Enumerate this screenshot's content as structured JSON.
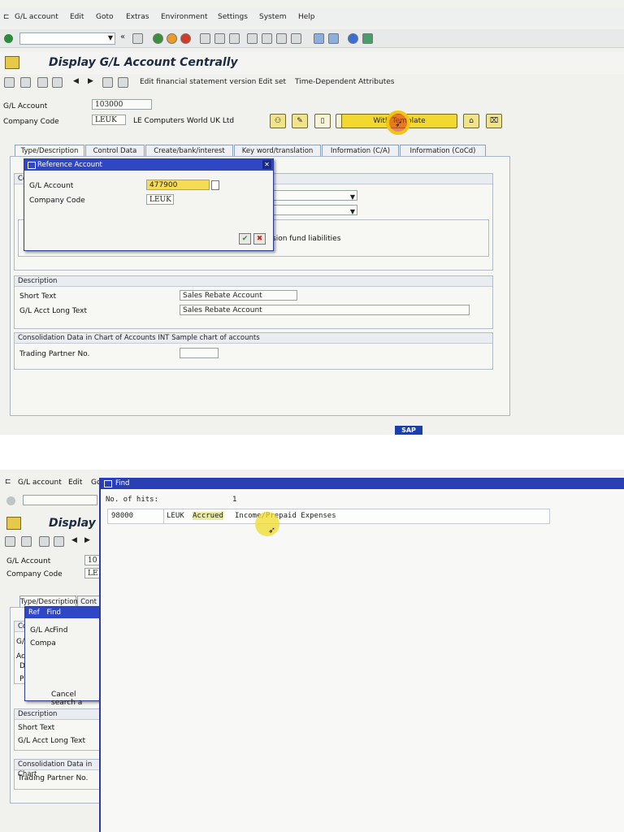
{
  "shot1": {
    "menu": [
      "G/L account",
      "Edit",
      "Goto",
      "Extras",
      "Environment",
      "Settings",
      "System",
      "Help"
    ],
    "title": "Display G/L Account Centrally",
    "app_toolbar": [
      "Edit financial statement version",
      "Edit set",
      "Time-Dependent Attributes"
    ],
    "gl_account_label": "G/L Account",
    "gl_account_value": "103000",
    "company_code_label": "Company Code",
    "company_code_value": "LEUK",
    "company_name": "LE Computers World UK Ltd",
    "with_template_label": "With Template",
    "tabs": [
      "Type/Description",
      "Control Data",
      "Create/bank/interest",
      "Key word/translation",
      "Information (C/A)",
      "Information (CoCd)"
    ],
    "pension_text": "sion fund liabilities",
    "description_header": "Description",
    "short_text_label": "Short Text",
    "short_text_value": "Sales Rebate Account",
    "long_text_label": "G/L Acct Long Text",
    "long_text_value": "Sales Rebate Account",
    "consolidation_header": "Consolidation Data in Chart of Accounts INT Sample chart of accounts",
    "trading_partner_label": "Trading Partner No.",
    "popup": {
      "title": "Reference Account",
      "gl_label": "G/L Account",
      "gl_value": "477900",
      "cc_label": "Company Code",
      "cc_value": "LEUK"
    },
    "sap_logo": "SAP"
  },
  "shot2": {
    "menu": [
      "G/L account",
      "Edit",
      "Go"
    ],
    "title": "Display G/",
    "gl_account_label": "G/L Account",
    "gl_partial": "10",
    "company_code_label": "Company Code",
    "cc_partial": "LE",
    "tab_partial": "Type/Description",
    "tab_partial2": "Cont",
    "inner_popup_ref": "Ref",
    "inner_popup_find": "Find",
    "inner_gl_partial": "G/L Ac",
    "inner_find_label": "Find",
    "inner_comp_partial": "Compa",
    "cancel_search": "Cancel search a",
    "description_header": "Description",
    "short_text_label": "Short Text",
    "long_text_label": "G/L Acct Long Text",
    "consolidation_partial": "Consolidation Data in Chart",
    "trading_partner_label": "Trading Partner No.",
    "find": {
      "title": "Find",
      "hits_label": "No. of hits:",
      "hits_value": "1",
      "result_account": "98000",
      "result_cc": "LEUK",
      "result_word1": "Accrued",
      "result_rest": "Income/Prepaid Expenses"
    }
  },
  "colors": {
    "sap_blue": "#2f47c4",
    "template_yellow": "#f3d82f",
    "highlight": "#f0c51a"
  }
}
